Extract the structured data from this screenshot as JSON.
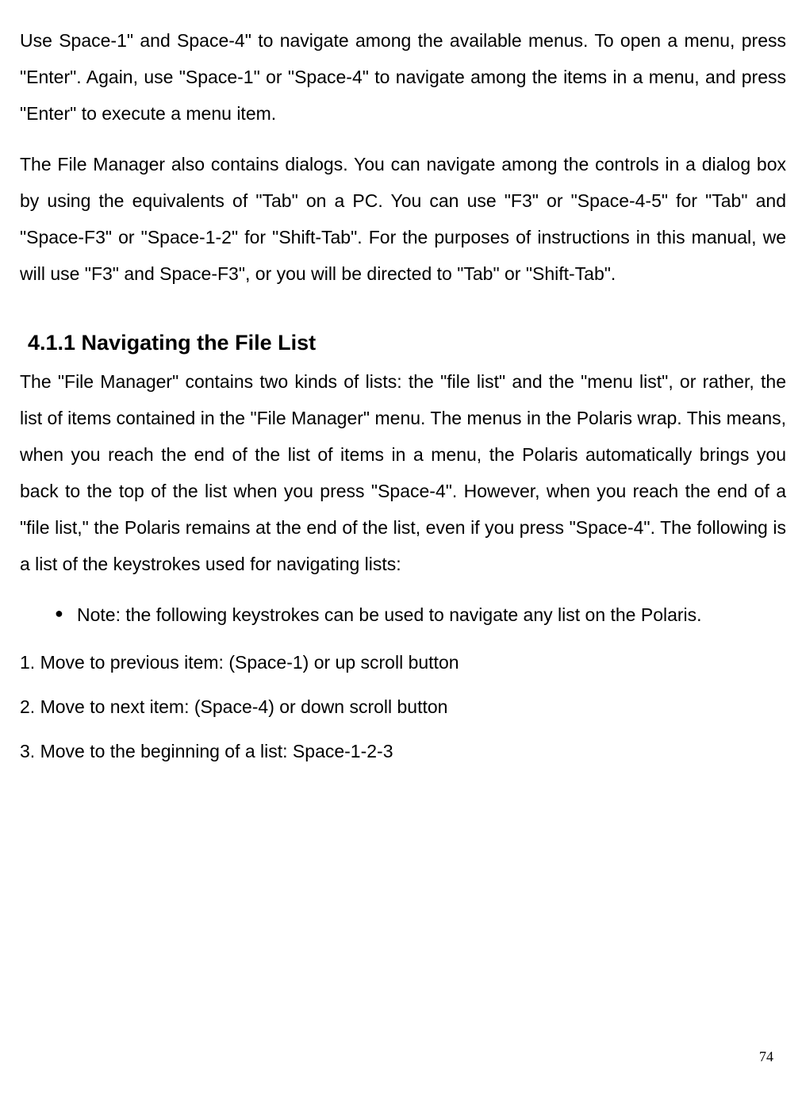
{
  "paragraphs": {
    "p1": "Use Space-1\" and Space-4\" to navigate among the available menus. To open a menu, press \"Enter\". Again, use \"Space-1\" or \"Space-4\" to navigate among the items in a menu, and press \"Enter\" to execute a menu item.",
    "p2": "The File Manager also contains dialogs. You can navigate among the controls in a dialog box by using the equivalents of \"Tab\" on a PC. You can use \"F3\" or \"Space-4-5\" for \"Tab\" and \"Space-F3\" or \"Space-1-2\" for \"Shift-Tab\". For the purposes of instructions in this manual, we will use \"F3\" and Space-F3\", or you will be directed to \"Tab\" or \"Shift-Tab\"."
  },
  "section": {
    "heading": "4.1.1 Navigating the File List",
    "body": "The \"File Manager\" contains two kinds of lists: the \"file list\" and the \"menu list\", or rather, the list of items contained in the \"File Manager\" menu. The menus in the Polaris wrap. This means, when you reach the end of the list of items in a menu, the Polaris automatically brings you back to the top of the list when you press \"Space-4\". However, when you reach the end of a \"file list,\" the Polaris remains at the end of the list, even if you press \"Space-4\". The following is a list of the keystrokes used for navigating lists:"
  },
  "bullet": "Note: the following keystrokes can be used to navigate any list on the Polaris.",
  "numbered": {
    "n1": "1. Move to previous item: (Space-1) or up scroll button",
    "n2": "2. Move to next item: (Space-4) or down scroll button",
    "n3": "3. Move to the beginning of a list: Space-1-2-3"
  },
  "page_number": "74"
}
